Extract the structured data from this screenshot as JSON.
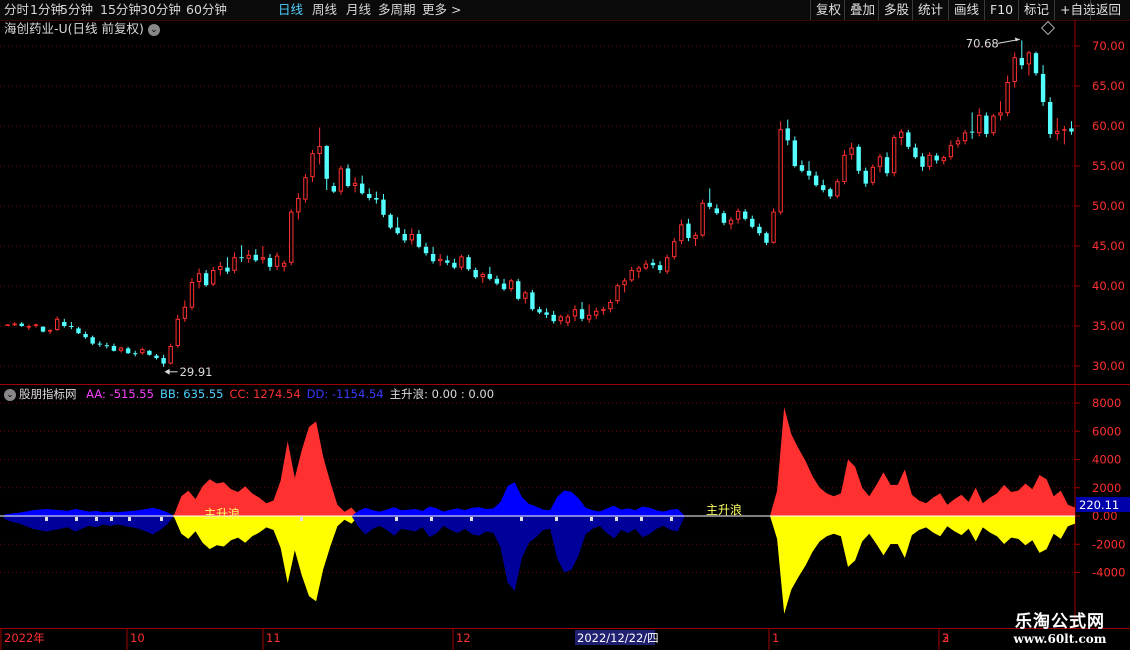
{
  "toolbar": {
    "left": [
      {
        "label": "分时",
        "active": false
      },
      {
        "label": "1分钟",
        "active": false
      },
      {
        "label": "5分钟",
        "active": false
      },
      {
        "label": "15分钟",
        "active": false
      },
      {
        "label": "30分钟",
        "active": false
      },
      {
        "label": "60分钟",
        "active": false
      },
      {
        "label": "日线",
        "active": true
      },
      {
        "label": "周线",
        "active": false
      },
      {
        "label": "月线",
        "active": false
      },
      {
        "label": "多周期",
        "active": false
      },
      {
        "label": "更多 >",
        "active": false
      }
    ],
    "right": [
      "复权",
      "叠加",
      "多股",
      "统计",
      "画线",
      "F10",
      "标记",
      "+自选",
      "返回"
    ]
  },
  "stock": {
    "title": "海创药业-U(日线 前复权)",
    "dropdown_icon": "chevron-down-icon"
  },
  "price_axis": {
    "labels": [
      "70.00",
      "65.00",
      "60.00",
      "55.00",
      "50.00",
      "45.00",
      "40.00",
      "35.00",
      "30.00"
    ]
  },
  "price_annotations": {
    "high": "70.68",
    "low": "29.91"
  },
  "indicator": {
    "name": "股朋指标网",
    "items": [
      {
        "text": "AA: -515.55",
        "color": "#ff40ff"
      },
      {
        "text": "BB: 635.55",
        "color": "#4fd0ff"
      },
      {
        "text": "CC: 1274.54",
        "color": "#ff3030"
      },
      {
        "text": "DD: -1154.54",
        "color": "#3a3aff"
      },
      {
        "text": "主升浪: 0.00 : 0.00",
        "color": "#dddddd"
      }
    ],
    "signal_label": "主升浪",
    "axis_labels": [
      "8000",
      "6000",
      "4000",
      "2000",
      "0.00",
      "-2000",
      "-4000"
    ],
    "current_value": "220.11"
  },
  "date_axis": {
    "labels": [
      "2022年",
      "10",
      "11",
      "12",
      "2022/12/22/四",
      "1",
      "2",
      "3"
    ]
  },
  "watermark": {
    "line1": "乐淘公式网",
    "line2": "www.60lt.com"
  },
  "colors": {
    "up": "#ff3030",
    "down": "#54ffff",
    "grid": "#7a0000",
    "yellow": "#ffff00",
    "blue": "#0000ff",
    "navy": "#00009a"
  },
  "chart_data": {
    "type": "candlestick",
    "ohlc": [
      [
        35.1,
        35.2,
        35.1,
        35.2
      ],
      [
        35.2,
        35.5,
        35.0,
        35.3
      ],
      [
        35.3,
        35.5,
        34.9,
        35.0
      ],
      [
        34.8,
        35.2,
        34.5,
        35.0
      ],
      [
        35.0,
        35.3,
        34.8,
        35.2
      ],
      [
        34.9,
        35.0,
        34.2,
        34.3
      ],
      [
        34.3,
        34.6,
        34.0,
        34.5
      ],
      [
        34.5,
        36.2,
        34.4,
        35.9
      ],
      [
        35.5,
        35.9,
        34.8,
        35.0
      ],
      [
        35.0,
        35.5,
        34.6,
        34.9
      ],
      [
        34.7,
        34.9,
        34.0,
        34.1
      ],
      [
        34.0,
        34.3,
        33.4,
        33.6
      ],
      [
        33.6,
        33.8,
        32.6,
        32.8
      ],
      [
        32.8,
        33.1,
        32.4,
        32.7
      ],
      [
        32.6,
        32.9,
        32.2,
        32.5
      ],
      [
        32.5,
        32.8,
        31.8,
        31.9
      ],
      [
        31.9,
        32.4,
        31.7,
        32.3
      ],
      [
        32.2,
        32.4,
        31.5,
        31.6
      ],
      [
        31.6,
        31.9,
        31.2,
        31.5
      ],
      [
        31.6,
        32.3,
        31.4,
        32.1
      ],
      [
        31.9,
        32.0,
        31.3,
        31.4
      ],
      [
        31.3,
        31.5,
        30.8,
        31.0
      ],
      [
        31.0,
        31.4,
        29.9,
        30.3
      ],
      [
        30.3,
        32.8,
        30.2,
        32.5
      ],
      [
        32.5,
        36.4,
        32.3,
        35.9
      ],
      [
        35.9,
        38.2,
        35.5,
        37.4
      ],
      [
        37.3,
        41.0,
        37.0,
        40.5
      ],
      [
        40.5,
        42.2,
        39.7,
        41.6
      ],
      [
        41.6,
        42.0,
        39.9,
        40.1
      ],
      [
        40.2,
        42.4,
        40.0,
        42.0
      ],
      [
        42.0,
        43.0,
        41.3,
        42.5
      ],
      [
        42.3,
        43.6,
        41.5,
        41.8
      ],
      [
        41.9,
        44.2,
        41.6,
        43.6
      ],
      [
        43.6,
        45.1,
        43.0,
        43.5
      ],
      [
        43.4,
        44.5,
        42.9,
        43.9
      ],
      [
        43.9,
        44.6,
        43.0,
        43.2
      ],
      [
        43.3,
        45.0,
        42.8,
        43.6
      ],
      [
        43.5,
        44.0,
        41.9,
        42.4
      ],
      [
        42.4,
        44.2,
        42.0,
        43.8
      ],
      [
        42.4,
        43.2,
        41.8,
        42.9
      ],
      [
        42.9,
        49.6,
        42.6,
        49.3
      ],
      [
        49.2,
        51.6,
        48.3,
        51.0
      ],
      [
        50.8,
        54.0,
        50.4,
        53.6
      ],
      [
        53.6,
        57.0,
        53.0,
        56.6
      ],
      [
        56.5,
        59.8,
        55.2,
        57.5
      ],
      [
        57.5,
        57.6,
        52.0,
        53.4
      ],
      [
        52.5,
        52.9,
        51.6,
        51.8
      ],
      [
        51.8,
        55.0,
        51.4,
        54.7
      ],
      [
        54.7,
        55.2,
        52.3,
        52.5
      ],
      [
        52.5,
        53.6,
        51.7,
        52.9
      ],
      [
        52.8,
        53.8,
        51.4,
        51.6
      ],
      [
        51.5,
        52.2,
        50.7,
        51.0
      ],
      [
        51.0,
        51.8,
        50.3,
        50.8
      ],
      [
        50.8,
        51.5,
        48.6,
        48.9
      ],
      [
        48.9,
        49.1,
        47.1,
        47.3
      ],
      [
        47.3,
        48.6,
        46.4,
        46.6
      ],
      [
        46.5,
        47.1,
        45.4,
        45.7
      ],
      [
        45.7,
        47.2,
        45.2,
        46.5
      ],
      [
        46.5,
        47.0,
        44.7,
        44.9
      ],
      [
        44.9,
        45.4,
        43.8,
        44.1
      ],
      [
        44.0,
        44.9,
        42.8,
        43.1
      ],
      [
        43.1,
        44.0,
        42.5,
        43.4
      ],
      [
        43.2,
        43.8,
        42.6,
        42.9
      ],
      [
        42.9,
        43.4,
        42.1,
        42.3
      ],
      [
        42.3,
        43.9,
        42.0,
        43.7
      ],
      [
        43.6,
        43.9,
        41.9,
        42.1
      ],
      [
        42.0,
        42.3,
        40.9,
        41.1
      ],
      [
        41.1,
        41.7,
        40.4,
        41.5
      ],
      [
        41.5,
        42.4,
        40.7,
        40.9
      ],
      [
        40.9,
        41.3,
        40.1,
        40.3
      ],
      [
        40.3,
        40.9,
        39.4,
        39.6
      ],
      [
        39.6,
        40.9,
        39.3,
        40.7
      ],
      [
        40.6,
        40.9,
        38.2,
        38.4
      ],
      [
        38.4,
        39.4,
        37.8,
        39.2
      ],
      [
        39.2,
        39.5,
        36.9,
        37.1
      ],
      [
        37.1,
        37.4,
        36.5,
        36.7
      ],
      [
        36.7,
        37.2,
        36.0,
        36.4
      ],
      [
        36.4,
        36.9,
        35.3,
        35.6
      ],
      [
        35.6,
        36.4,
        35.2,
        36.2
      ],
      [
        35.4,
        36.5,
        35.0,
        36.2
      ],
      [
        36.2,
        37.6,
        35.6,
        37.1
      ],
      [
        37.1,
        38.0,
        35.6,
        35.9
      ],
      [
        35.8,
        37.7,
        35.4,
        36.4
      ],
      [
        36.3,
        37.3,
        35.9,
        36.9
      ],
      [
        36.9,
        37.4,
        36.4,
        37.1
      ],
      [
        37.1,
        38.3,
        36.7,
        38.0
      ],
      [
        38.1,
        40.3,
        37.8,
        40.1
      ],
      [
        40.1,
        41.0,
        39.2,
        40.7
      ],
      [
        40.7,
        42.4,
        40.5,
        42.0
      ],
      [
        41.8,
        42.5,
        41.0,
        42.3
      ],
      [
        42.2,
        43.2,
        42.0,
        42.8
      ],
      [
        42.9,
        43.4,
        42.2,
        42.6
      ],
      [
        42.6,
        43.1,
        41.6,
        42.0
      ],
      [
        41.8,
        43.9,
        41.5,
        43.6
      ],
      [
        43.6,
        46.0,
        43.3,
        45.6
      ],
      [
        45.6,
        48.3,
        45.2,
        47.7
      ],
      [
        47.8,
        48.4,
        45.6,
        46.0
      ],
      [
        45.9,
        46.7,
        45.0,
        46.4
      ],
      [
        46.3,
        50.8,
        46.1,
        50.4
      ],
      [
        50.4,
        52.2,
        49.6,
        49.9
      ],
      [
        49.7,
        50.2,
        48.9,
        49.1
      ],
      [
        49.1,
        49.4,
        47.6,
        47.9
      ],
      [
        47.7,
        48.6,
        47.1,
        48.3
      ],
      [
        48.3,
        49.7,
        47.8,
        49.4
      ],
      [
        49.3,
        49.6,
        48.2,
        48.4
      ],
      [
        48.4,
        48.8,
        47.2,
        47.4
      ],
      [
        47.4,
        47.8,
        46.3,
        46.6
      ],
      [
        46.6,
        46.8,
        45.1,
        45.4
      ],
      [
        45.4,
        49.7,
        45.3,
        49.3
      ],
      [
        49.2,
        60.6,
        48.9,
        59.6
      ],
      [
        59.7,
        60.8,
        57.6,
        58.2
      ],
      [
        58.2,
        58.7,
        54.8,
        55.0
      ],
      [
        55.1,
        55.7,
        54.2,
        54.4
      ],
      [
        54.4,
        55.6,
        53.3,
        53.8
      ],
      [
        53.8,
        54.3,
        52.4,
        52.6
      ],
      [
        52.6,
        53.3,
        51.7,
        52.0
      ],
      [
        52.1,
        52.3,
        50.9,
        51.2
      ],
      [
        51.2,
        53.4,
        51.0,
        53.1
      ],
      [
        53.0,
        57.0,
        52.7,
        56.4
      ],
      [
        56.4,
        57.9,
        55.8,
        57.3
      ],
      [
        57.4,
        57.7,
        54.0,
        54.4
      ],
      [
        54.4,
        54.8,
        52.4,
        52.8
      ],
      [
        52.9,
        55.2,
        52.6,
        54.9
      ],
      [
        54.9,
        56.5,
        54.2,
        56.2
      ],
      [
        56.1,
        56.7,
        53.7,
        54.1
      ],
      [
        54.1,
        58.9,
        53.7,
        58.6
      ],
      [
        58.5,
        59.6,
        57.6,
        59.3
      ],
      [
        59.2,
        59.5,
        57.1,
        57.4
      ],
      [
        57.3,
        57.8,
        55.9,
        56.1
      ],
      [
        56.2,
        56.6,
        54.4,
        54.9
      ],
      [
        54.9,
        56.7,
        54.5,
        56.4
      ],
      [
        56.3,
        56.6,
        55.3,
        55.7
      ],
      [
        55.6,
        56.3,
        55.2,
        56.1
      ],
      [
        56.1,
        58.2,
        55.8,
        57.6
      ],
      [
        57.7,
        58.6,
        57.3,
        58.2
      ],
      [
        58.1,
        59.5,
        57.7,
        59.2
      ],
      [
        59.3,
        61.7,
        58.4,
        59.2
      ],
      [
        59.1,
        62.2,
        58.7,
        61.4
      ],
      [
        61.3,
        61.7,
        58.6,
        59.0
      ],
      [
        59.1,
        61.5,
        58.8,
        61.3
      ],
      [
        61.3,
        63.1,
        60.7,
        61.7
      ],
      [
        61.6,
        66.3,
        61.2,
        65.5
      ],
      [
        65.5,
        69.2,
        64.8,
        68.6
      ],
      [
        68.5,
        70.7,
        67.1,
        67.6
      ],
      [
        67.7,
        69.4,
        66.3,
        69.2
      ],
      [
        69.1,
        69.3,
        66.3,
        66.6
      ],
      [
        66.5,
        67.6,
        62.5,
        63.0
      ],
      [
        63.0,
        63.6,
        58.5,
        59.0
      ],
      [
        59.0,
        61.0,
        58.2,
        59.4
      ],
      [
        59.5,
        60.0,
        57.7,
        59.6
      ],
      [
        59.7,
        60.6,
        58.9,
        59.3
      ]
    ],
    "y_range": [
      28.0,
      73.0
    ],
    "high_marker": "70.68",
    "low_marker": "29.91",
    "indicator_series": [
      {
        "name": "CC",
        "color": "red",
        "values": [
          0,
          0,
          0,
          0,
          0,
          0,
          0,
          0,
          0,
          0,
          0,
          0,
          0,
          0,
          0,
          0,
          0,
          0,
          0,
          0,
          0,
          0,
          0,
          0,
          100,
          1400,
          1800,
          1200,
          2100,
          2600,
          2300,
          2400,
          1900,
          1700,
          2100,
          1600,
          1300,
          900,
          1100,
          2500,
          5300,
          2700,
          4700,
          6300,
          6700,
          4200,
          2400,
          800,
          300,
          600,
          0,
          0,
          0,
          0,
          0,
          0,
          0,
          0,
          0,
          0,
          0,
          0,
          0,
          0,
          0,
          0,
          0,
          0,
          0,
          0,
          0,
          0,
          0,
          0,
          0,
          0,
          0,
          0,
          0,
          0,
          0,
          0,
          0,
          0,
          0,
          0,
          0,
          0,
          0,
          0,
          0,
          0,
          0,
          0,
          0,
          0,
          0,
          0,
          0,
          0,
          0,
          0,
          0,
          0,
          0,
          0,
          0,
          0,
          0,
          1800,
          7700,
          5800,
          4800,
          3900,
          2800,
          2000,
          1600,
          1400,
          1600,
          4000,
          3500,
          2000,
          1400,
          2200,
          3100,
          2200,
          2200,
          3300,
          1500,
          1100,
          900,
          1300,
          1600,
          800,
          1200,
          1500,
          1000,
          2000,
          900,
          1300,
          1600,
          2200,
          1700,
          1800,
          2300,
          1900,
          2900,
          2600,
          1400,
          1800,
          800,
          600
        ]
      },
      {
        "name": "DD",
        "color": "blue",
        "values": [
          -200,
          -400,
          -500,
          -700,
          -900,
          -1000,
          -1100,
          -1000,
          -900,
          -800,
          -1100,
          -900,
          -700,
          -800,
          -600,
          -700,
          -600,
          -700,
          -800,
          -900,
          -1100,
          -1300,
          -1000,
          -600,
          0,
          0,
          0,
          0,
          0,
          0,
          0,
          0,
          0,
          0,
          0,
          0,
          0,
          0,
          0,
          0,
          0,
          0,
          0,
          0,
          0,
          0,
          0,
          0,
          0,
          0,
          -800,
          -1300,
          -900,
          -700,
          -1000,
          -1400,
          -900,
          -1000,
          -1100,
          -800,
          -1500,
          -1200,
          -700,
          -1000,
          -1200,
          -900,
          -1300,
          -1400,
          -1100,
          -1200,
          -2200,
          -4700,
          -5300,
          -3000,
          -1900,
          -1500,
          -1000,
          -900,
          -3000,
          -4000,
          -3800,
          -2800,
          -1300,
          -900,
          -700,
          -1200,
          -1600,
          -1000,
          -1200,
          -900,
          -1500,
          -1300,
          -900,
          -700,
          -1000,
          -1100,
          0,
          0,
          0,
          0,
          0,
          0,
          0,
          0,
          0,
          0,
          0,
          0,
          0,
          0,
          0,
          0,
          0,
          0,
          0,
          0,
          0,
          0,
          0,
          0,
          0,
          0,
          0,
          0,
          0,
          0,
          0,
          0,
          0,
          0,
          0,
          0,
          0,
          0,
          0,
          0,
          0,
          0,
          0,
          0,
          0,
          0,
          0,
          0,
          0,
          0,
          0,
          0,
          0,
          0
        ]
      }
    ]
  }
}
